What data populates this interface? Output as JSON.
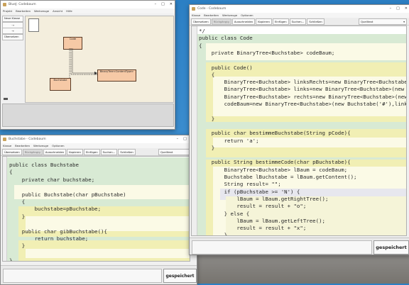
{
  "bluej": {
    "title": "BlueJ: Codebaum",
    "menu": [
      "Projekt",
      "Bearbeiten",
      "Werkzeuge",
      "Ansicht",
      "Hilfe"
    ],
    "new_class": "Neue Klasse",
    "compile": "Übersetzen",
    "classes": [
      {
        "name": "Code"
      },
      {
        "name": "Buchstabe"
      },
      {
        "name": "BinaryTree<ContentType>"
      }
    ]
  },
  "code_editor": {
    "title": "Code - Codebaum",
    "menu": [
      "Klasse",
      "Bearbeiten",
      "Werkzeuge",
      "Optionen"
    ],
    "toolbar": [
      "Übersetzen",
      "Rückgängig",
      "Ausschneiden",
      "Kopieren",
      "Einfügen",
      "Suchen...",
      "Schließen"
    ],
    "view_select": "Quelltext",
    "lines": [
      "*/",
      "public class Code",
      "{",
      "    private BinaryTree<Buchstabe> codeBaum;",
      "",
      "    public Code()",
      "    {",
      "        BinaryTree<Buchstabe> linksRechts=new BinaryTree<Buchstabe>(new Buchstabe('R'),",
      "        BinaryTree<Buchstabe> links=new BinaryTree<Buchstabe>(new Buchstabe('L'));",
      "        BinaryTree<Buchstabe> rechts=new BinaryTree<Buchstabe>(new Buchstabe('E'));",
      "        codeBaum=new BinaryTree<Buchstabe>(new Buchstabe('#'),links,rechts);",
      "",
      "    }",
      "",
      "    public char bestimmeBuchstabe(String pCode){",
      "        return 'a';",
      "    }",
      "",
      "    public String bestimmeCode(char pBuchstabe){",
      "        BinaryTree<Buchstabe> lBaum = codeBaum;",
      "        Buchstabe lBuchstabe = lBaum.getContent();",
      "        String result= \"\";",
      "        if (pBuchstabe >= 'N') {",
      "            lBaum = lBaum.getRightTree();",
      "            result = result + \"o\";",
      "        } else {",
      "            lBaum = lBaum.getLeftTree();",
      "            result = result + \"x\";",
      "        }"
    ],
    "status": "gespeichert"
  },
  "buchstabe_editor": {
    "title": "Buchstabe - Codebaum",
    "menu": [
      "Klasse",
      "Bearbeiten",
      "Werkzeuge",
      "Optionen"
    ],
    "toolbar": [
      "Übersetzen",
      "Rückgängig",
      "Ausschneiden",
      "Kopieren",
      "Einfügen",
      "Suchen...",
      "Schließen"
    ],
    "view_select": "Quelltext",
    "lines": [
      "public class Buchstabe",
      "{",
      "    private char buchstabe;",
      "",
      "    public Buchstabe(char pBuchstabe)",
      "    {",
      "        buchstabe=pBuchstabe;",
      "    }",
      "",
      "    public char gibBuchstabe(){",
      "        return buchstabe;",
      "    }",
      "",
      "}"
    ],
    "status": "gespeichert"
  },
  "colors": {
    "class_block": "#d8ead4",
    "method_block": "#f1efb4",
    "inner_block": "#fbfae6",
    "accent_blue": "#2c7fc4"
  }
}
